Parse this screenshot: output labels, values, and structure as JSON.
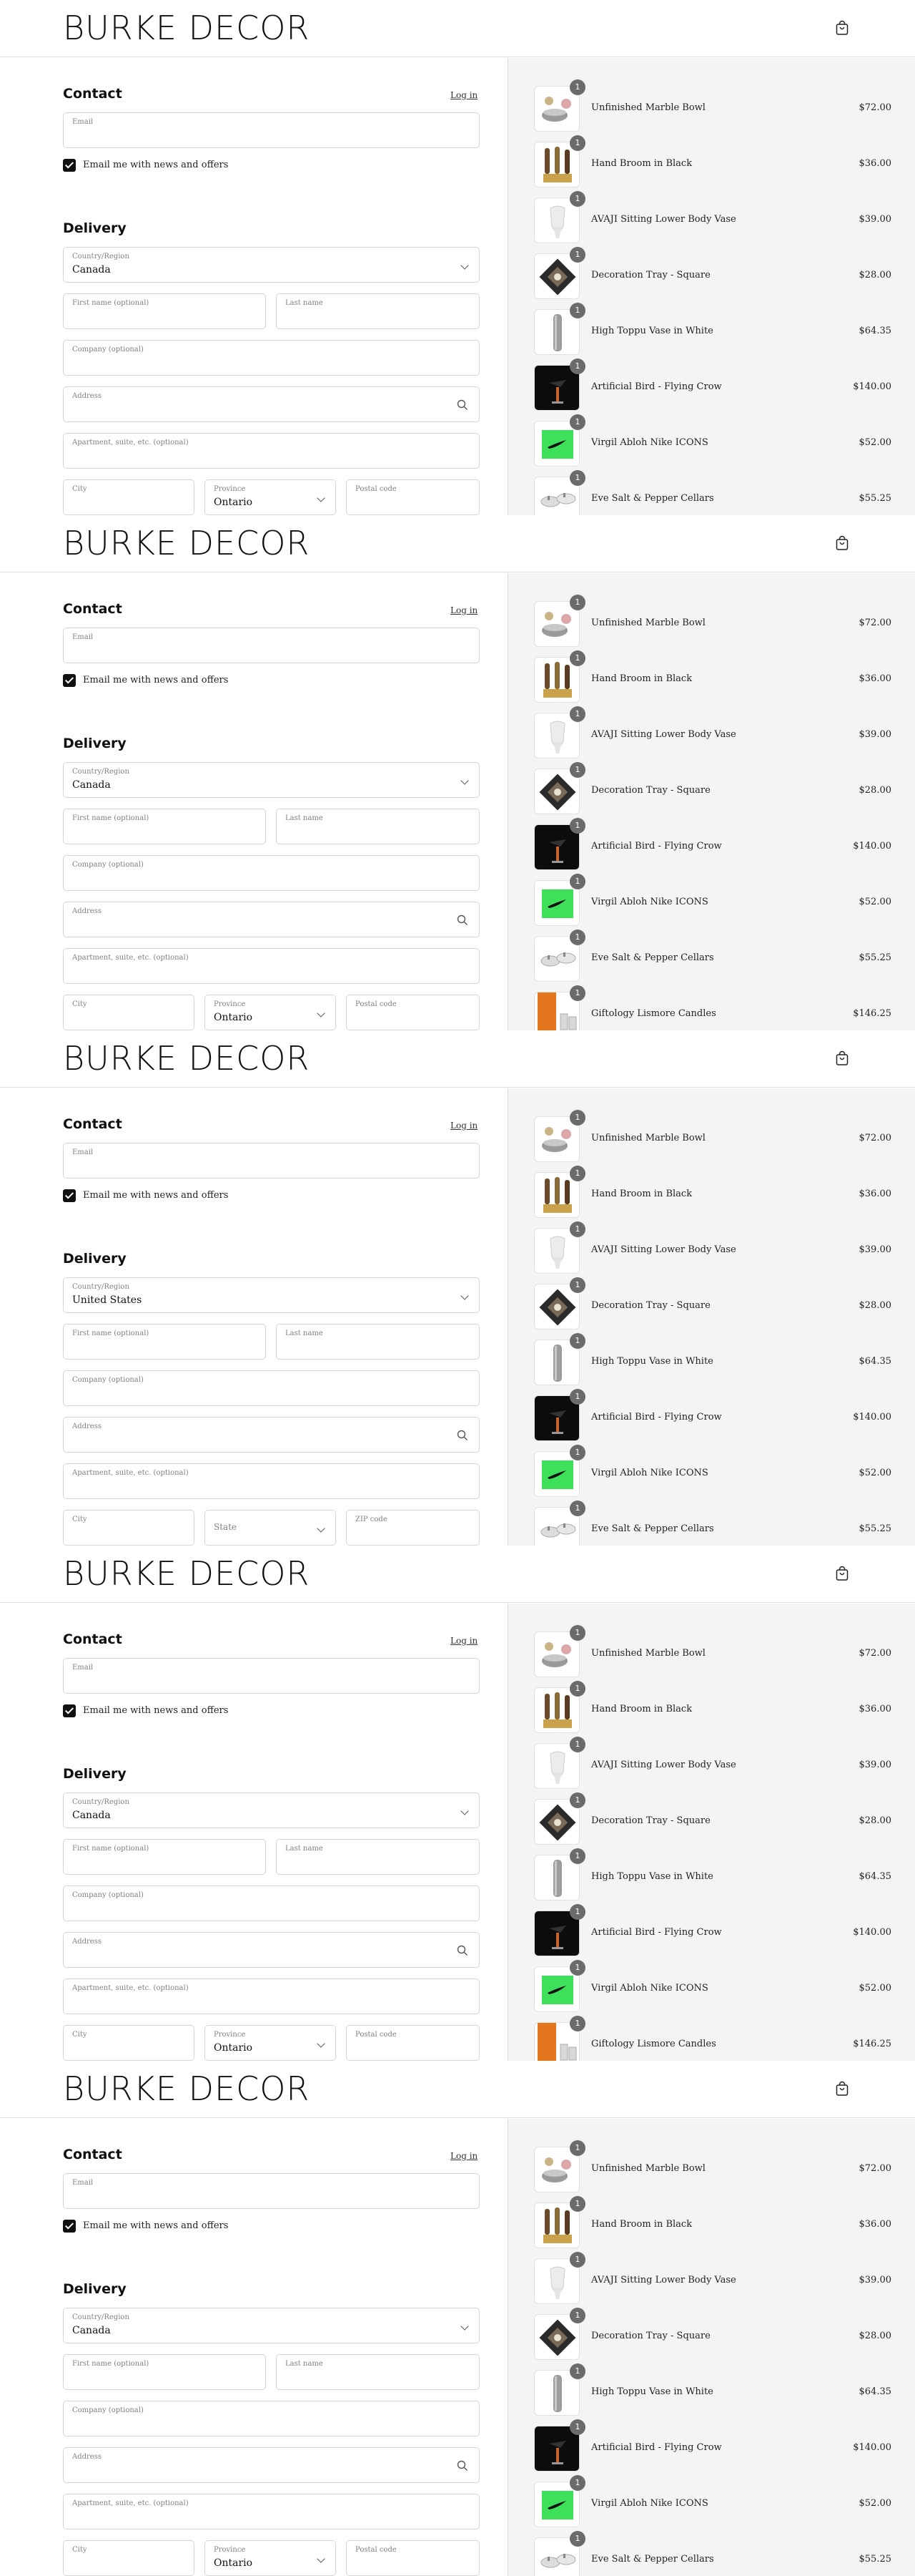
{
  "brand": {
    "logo": "BURKE DECOR",
    "cart_icon": "shopping-bag-icon"
  },
  "contact": {
    "heading": "Contact",
    "login": "Log in",
    "email_placeholder": "Email",
    "newsletter": "Email me with news and offers",
    "newsletter_checked": true
  },
  "delivery": {
    "heading": "Delivery",
    "country_label": "Country/Region",
    "first_name": "First name (optional)",
    "last_name": "Last name",
    "company": "Company (optional)",
    "address": "Address",
    "apartment": "Apartment, suite, etc. (optional)",
    "city": "City"
  },
  "region_ca": {
    "country": "Canada",
    "province_label": "Province",
    "province_value": "Ontario",
    "postal_label": "Postal code"
  },
  "region_us": {
    "country": "United States",
    "state_label": "State",
    "zip_label": "ZIP code"
  },
  "products": {
    "marble": {
      "name": "Unfinished Marble Bowl",
      "price": "$72.00",
      "qty": "1"
    },
    "broom": {
      "name": "Hand Broom in Black",
      "price": "$36.00",
      "qty": "1"
    },
    "avaji": {
      "name": "AVAJI Sitting Lower Body Vase",
      "price": "$39.00",
      "qty": "1"
    },
    "tray": {
      "name": "Decoration Tray - Square",
      "price": "$28.00",
      "qty": "1"
    },
    "toppu": {
      "name": "High Toppu Vase in White",
      "price": "$64.35",
      "qty": "1"
    },
    "bird": {
      "name": "Artificial Bird - Flying Crow",
      "price": "$140.00",
      "qty": "1"
    },
    "virgil": {
      "name": "Virgil Abloh Nike ICONS",
      "price": "$52.00",
      "qty": "1"
    },
    "eve": {
      "name": "Eve Salt & Pepper Cellars",
      "price": "$55.25",
      "qty": "1"
    },
    "lismore": {
      "name": "Giftology Lismore Candles",
      "price": "$146.25",
      "qty": "1"
    }
  }
}
